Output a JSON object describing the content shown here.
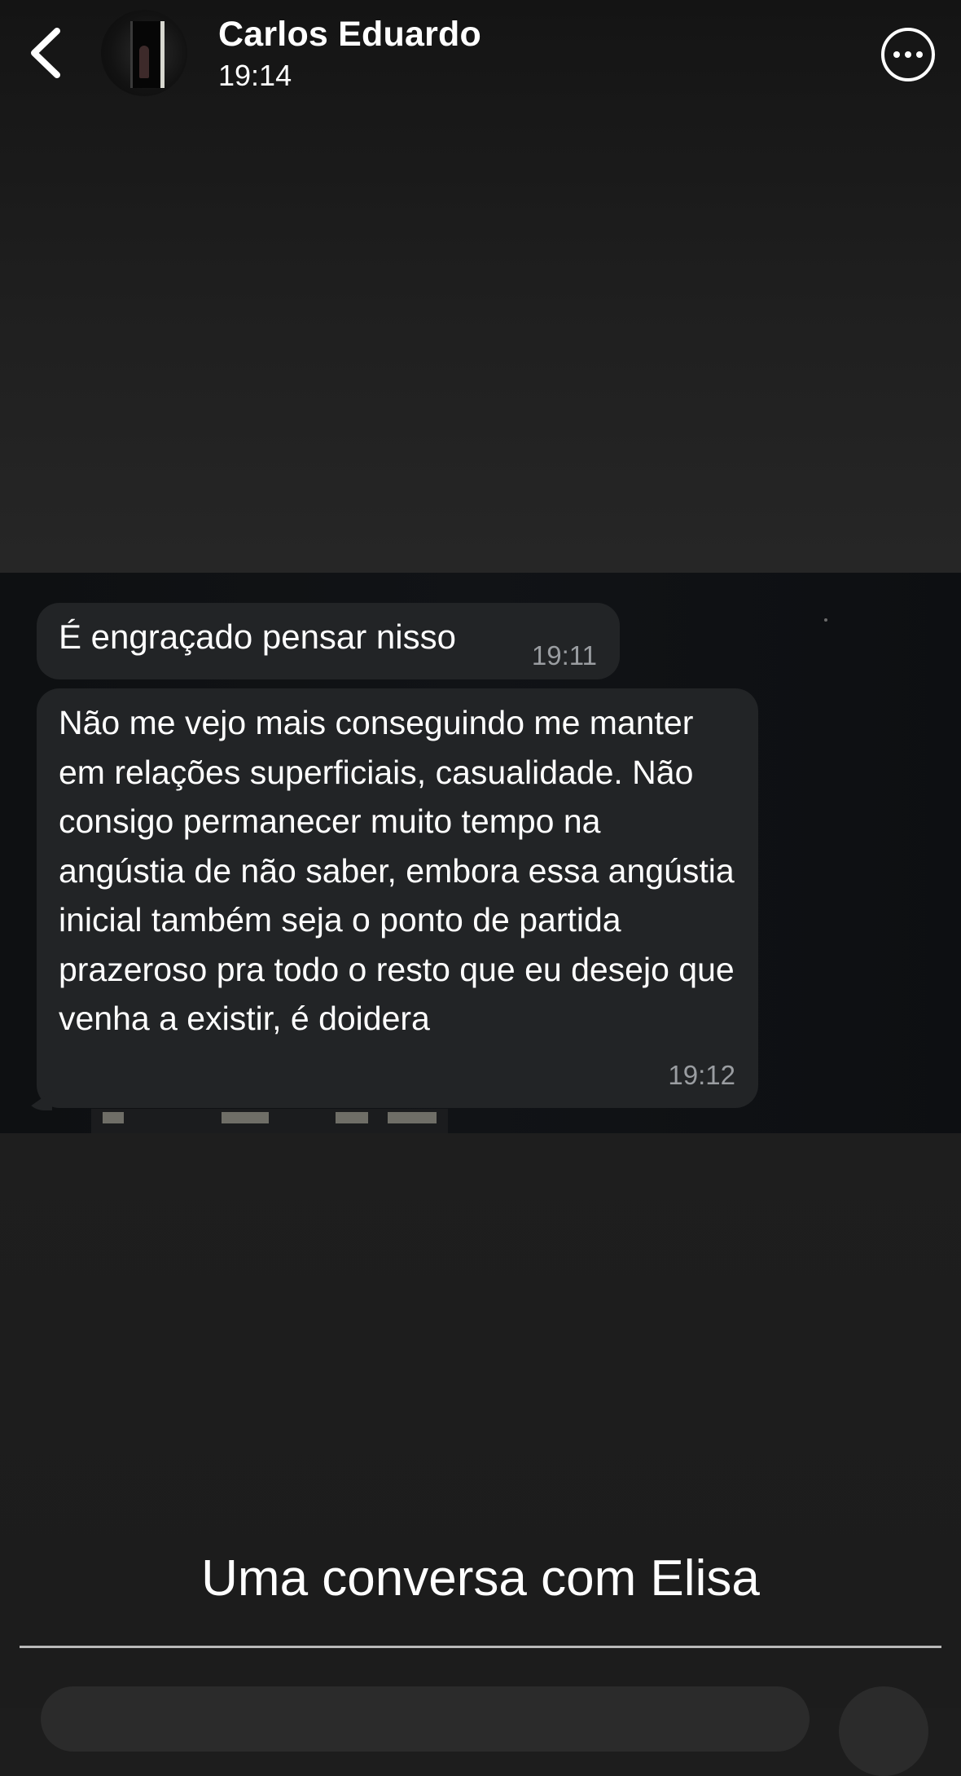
{
  "header": {
    "contact_name": "Carlos Eduardo",
    "time": "19:14",
    "icons": {
      "back": "chevron-left-icon",
      "more": "more-horizontal-circle-icon"
    }
  },
  "messages": [
    {
      "text": "É engraçado pensar nisso",
      "time": "19:11"
    },
    {
      "text": "Não me vejo mais conseguindo me manter em relações superficiais, casualidade. Não consigo permanecer muito tempo na angústia de não saber, embora essa angústia inicial também seja o ponto de partida prazeroso pra todo o resto que eu desejo que venha a existir, é doidera",
      "time": "19:12"
    }
  ],
  "caption": "Uma conversa com Elisa",
  "colors": {
    "background": "#1d1d1d",
    "bubble": "#222426",
    "timestamp": "#9a9da1",
    "text": "#ffffff"
  }
}
